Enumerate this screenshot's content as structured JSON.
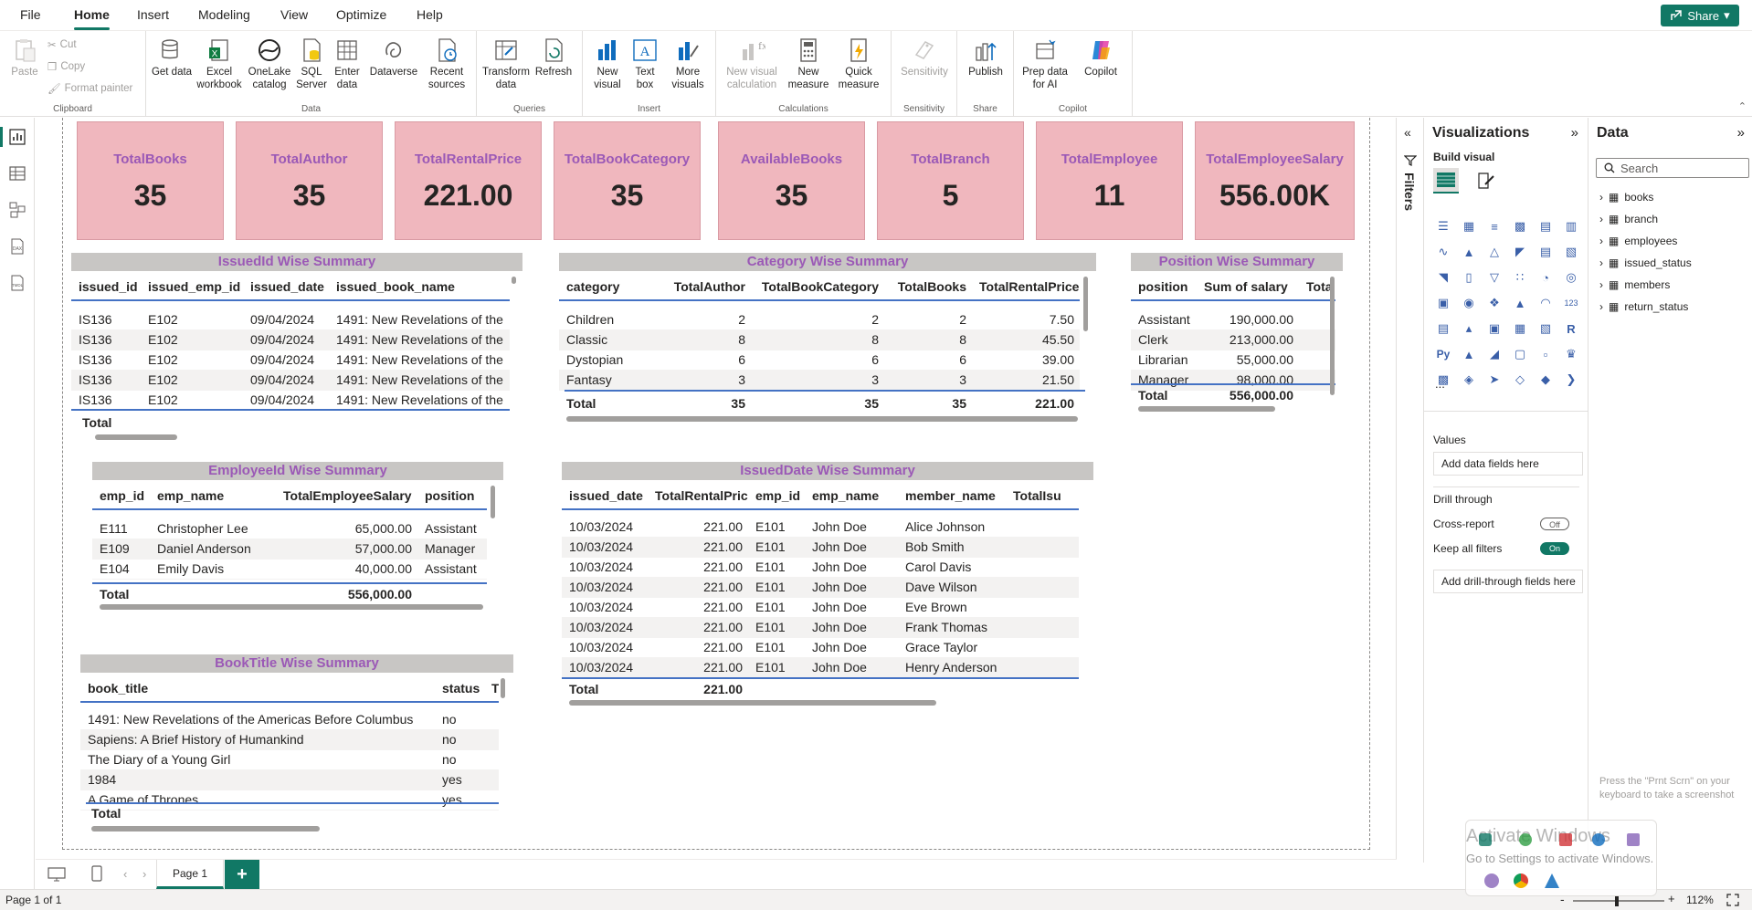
{
  "menu": {
    "items": [
      "File",
      "Home",
      "Insert",
      "Modeling",
      "View",
      "Optimize",
      "Help"
    ],
    "active": "Home",
    "share": "Share"
  },
  "ribbon": {
    "clipboard": {
      "paste": "Paste",
      "cut": "Cut",
      "copy": "Copy",
      "format_painter": "Format painter",
      "label": "Clipboard"
    },
    "data": {
      "get_data": "Get data",
      "excel": "Excel workbook",
      "onelake": "OneLake catalog",
      "sql": "SQL Server",
      "enter": "Enter data",
      "dataverse": "Dataverse",
      "recent": "Recent sources",
      "label": "Data"
    },
    "queries": {
      "transform": "Transform data",
      "refresh": "Refresh",
      "label": "Queries"
    },
    "insert": {
      "new_visual": "New visual",
      "text_box": "Text box",
      "more_visuals": "More visuals",
      "label": "Insert"
    },
    "calculations": {
      "new_visual_calc": "New visual calculation",
      "new_measure": "New measure",
      "quick_measure": "Quick measure",
      "label": "Calculations"
    },
    "sensitivity": {
      "btn": "Sensitivity",
      "label": "Sensitivity"
    },
    "share": {
      "publish": "Publish",
      "label": "Share"
    },
    "copilot": {
      "prep": "Prep data for AI",
      "copilot": "Copilot",
      "label": "Copilot"
    }
  },
  "cards": [
    {
      "label": "TotalBooks",
      "value": "35"
    },
    {
      "label": "TotalAuthor",
      "value": "35"
    },
    {
      "label": "TotalRentalPrice",
      "value": "221.00"
    },
    {
      "label": "TotalBookCategory",
      "value": "35"
    },
    {
      "label": "AvailableBooks",
      "value": "35"
    },
    {
      "label": "TotalBranch",
      "value": "5"
    },
    {
      "label": "TotalEmployee",
      "value": "11"
    },
    {
      "label": "TotalEmployeeSalary",
      "value": "556.00K"
    }
  ],
  "issued_summary": {
    "title": "IssuedId Wise Summary",
    "columns": [
      "issued_id",
      "issued_emp_id",
      "issued_date",
      "issued_book_name"
    ],
    "rows": [
      [
        "IS136",
        "E102",
        "09/04/2024",
        "1491: New Revelations of the"
      ],
      [
        "IS136",
        "E102",
        "09/04/2024",
        "1491: New Revelations of the"
      ],
      [
        "IS136",
        "E102",
        "09/04/2024",
        "1491: New Revelations of the"
      ],
      [
        "IS136",
        "E102",
        "09/04/2024",
        "1491: New Revelations of the"
      ],
      [
        "IS136",
        "E102",
        "09/04/2024",
        "1491: New Revelations of the"
      ]
    ],
    "total": "Total"
  },
  "category_summary": {
    "title": "Category Wise Summary",
    "columns": [
      "category",
      "TotalAuthor",
      "TotalBookCategory",
      "TotalBooks",
      "TotalRentalPrice"
    ],
    "rows": [
      [
        "Children",
        "2",
        "2",
        "2",
        "7.50"
      ],
      [
        "Classic",
        "8",
        "8",
        "8",
        "45.50"
      ],
      [
        "Dystopian",
        "6",
        "6",
        "6",
        "39.00"
      ],
      [
        "Fantasy",
        "3",
        "3",
        "3",
        "21.50"
      ]
    ],
    "total": [
      "Total",
      "35",
      "35",
      "35",
      "221.00"
    ]
  },
  "position_summary": {
    "title": "Position Wise Summary",
    "columns": [
      "position",
      "Sum of salary",
      "Tota"
    ],
    "rows": [
      [
        "Assistant",
        "190,000.00"
      ],
      [
        "Clerk",
        "213,000.00"
      ],
      [
        "Librarian",
        "55,000.00"
      ],
      [
        "Manager",
        "98,000.00"
      ]
    ],
    "total": [
      "Total",
      "556,000.00"
    ]
  },
  "employee_summary": {
    "title": "EmployeeId Wise Summary",
    "columns": [
      "emp_id",
      "emp_name",
      "TotalEmployeeSalary",
      "position"
    ],
    "rows": [
      [
        "E111",
        "Christopher Lee",
        "65,000.00",
        "Assistant"
      ],
      [
        "E109",
        "Daniel Anderson",
        "57,000.00",
        "Manager"
      ],
      [
        "E104",
        "Emily Davis",
        "40,000.00",
        "Assistant"
      ]
    ],
    "total": [
      "Total",
      "556,000.00"
    ]
  },
  "issueddate_summary": {
    "title": "IssuedDate Wise Summary",
    "columns": [
      "issued_date",
      "TotalRentalPrice",
      "emp_id",
      "emp_name",
      "member_name",
      "TotalIsu"
    ],
    "rows": [
      [
        "10/03/2024",
        "221.00",
        "E101",
        "John Doe",
        "Alice Johnson"
      ],
      [
        "10/03/2024",
        "221.00",
        "E101",
        "John Doe",
        "Bob Smith"
      ],
      [
        "10/03/2024",
        "221.00",
        "E101",
        "John Doe",
        "Carol Davis"
      ],
      [
        "10/03/2024",
        "221.00",
        "E101",
        "John Doe",
        "Dave Wilson"
      ],
      [
        "10/03/2024",
        "221.00",
        "E101",
        "John Doe",
        "Eve Brown"
      ],
      [
        "10/03/2024",
        "221.00",
        "E101",
        "John Doe",
        "Frank Thomas"
      ],
      [
        "10/03/2024",
        "221.00",
        "E101",
        "John Doe",
        "Grace Taylor"
      ],
      [
        "10/03/2024",
        "221.00",
        "E101",
        "John Doe",
        "Henry Anderson"
      ]
    ],
    "total": [
      "Total",
      "221.00"
    ]
  },
  "booktitle_summary": {
    "title": "BookTitle Wise Summary",
    "columns": [
      "book_title",
      "status",
      "T"
    ],
    "rows": [
      [
        "1491: New Revelations of the Americas Before Columbus",
        "no"
      ],
      [
        "Sapiens: A Brief History of Humankind",
        "no"
      ],
      [
        "The Diary of a Young Girl",
        "no"
      ],
      [
        "1984",
        "yes"
      ],
      [
        "A Game of Thrones",
        "yes"
      ]
    ],
    "total": "Total"
  },
  "filters": {
    "label": "Filters"
  },
  "visualizations": {
    "title": "Visualizations",
    "build_visual": "Build visual",
    "values_label": "Values",
    "values_placeholder": "Add data fields here",
    "drill_through": "Drill through",
    "cross_report": "Cross-report",
    "cross_report_state": "Off",
    "keep_filters": "Keep all filters",
    "keep_filters_state": "On",
    "drill_placeholder": "Add drill-through fields here",
    "more": "..."
  },
  "data_pane": {
    "title": "Data",
    "search_placeholder": "Search",
    "tables": [
      "books",
      "branch",
      "employees",
      "issued_status",
      "members",
      "return_status"
    ]
  },
  "pages": {
    "tabs": [
      "Page 1"
    ],
    "add": "+"
  },
  "status": {
    "page": "Page 1 of 1",
    "zoom": "112%",
    "minus": "-",
    "plus": "+"
  },
  "overlay": {
    "line1": "Activate Windows",
    "line2": "Go to Settings to activate Windows.",
    "hint": "Press the \"Prnt Scrn\" on your keyboard to take a screenshot"
  },
  "colors": {
    "accent": "#117865",
    "card_bg": "#f0b7be",
    "title_text": "#9b59b6",
    "header_line": "#4472c4"
  }
}
